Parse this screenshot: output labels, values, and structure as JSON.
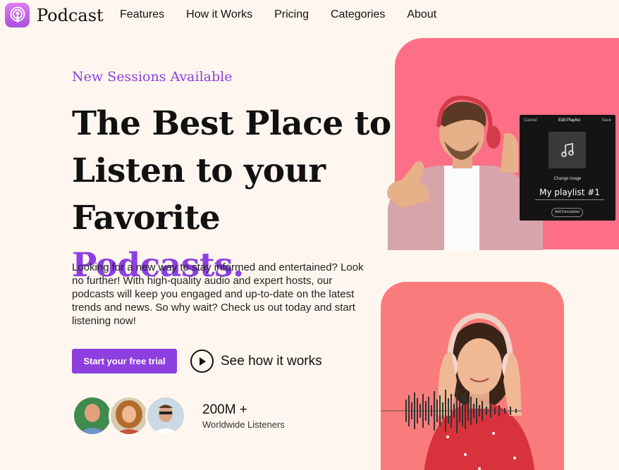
{
  "brand": {
    "name": "Podcast",
    "icon": "podcast-icon",
    "accent": "#8d3fe0"
  },
  "nav": [
    "Features",
    "How it Works",
    "Pricing",
    "Categories",
    "About"
  ],
  "hero": {
    "eyebrow": "New Sessions Available",
    "headline_line1": "The Best Place to",
    "headline_line2": "Listen to your",
    "headline_line3_plain": "Favorite ",
    "headline_line3_accent": "Podcasts.",
    "description": "Looking for a new way to stay informed and entertained? Look no further! With high-quality audio and expert hosts, our podcasts will keep you engaged and up-to-date on the latest trends and news. So why wait? Check us out today and start listening now!",
    "cta_primary": "Start your free trial",
    "cta_secondary": "See how it works",
    "play_icon": "play-icon"
  },
  "stats": {
    "value": "200M +",
    "label": "Worldwide Listeners"
  },
  "playlist_card": {
    "cancel": "Cancel",
    "title": "Edit Playlist",
    "save": "Save",
    "change_image": "Change image",
    "name": "My playlist #1",
    "add_description": "Add Description"
  },
  "colors": {
    "card_pink": "#fd6f87",
    "card_coral": "#fa7b7b",
    "background": "#fff7ef"
  }
}
